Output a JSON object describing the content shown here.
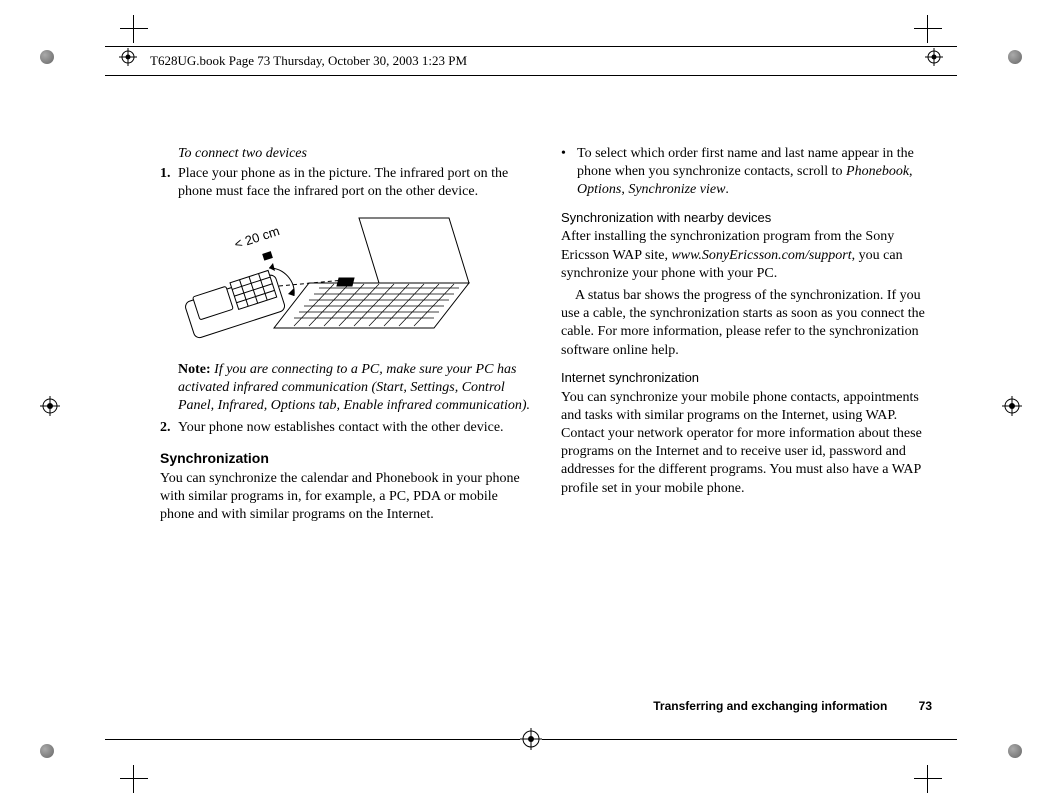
{
  "header": {
    "text": "T628UG.book  Page 73  Thursday, October 30, 2003  1:23 PM"
  },
  "left": {
    "subhead": "To connect two devices",
    "step1_num": "1.",
    "step1_body": "Place your phone as in the picture. The infrared port on the phone must face the infrared port on the other device.",
    "figure_label": "20 cm",
    "figure_lt": "<",
    "note_label": "Note:",
    "note_body": "If you are connecting to a PC, make sure your PC has activated infrared communication (Start, Settings, Control Panel, Infrared, Options tab, Enable infrared communication).",
    "step2_num": "2.",
    "step2_body": "Your phone now establishes contact with the other device.",
    "h2": "Synchronization",
    "p1": "You can synchronize the calendar and Phonebook in your phone with similar programs in, for example, a PC, PDA or mobile phone and with similar programs on the Internet."
  },
  "right": {
    "bullet_pre": "To select which order first name and last name appear in the phone when you synchronize contacts, scroll to ",
    "bullet_i1": "Phonebook",
    "bullet_sep1": ", ",
    "bullet_i2": "Options",
    "bullet_sep2": ", ",
    "bullet_i3": "Synchronize view",
    "bullet_end": ".",
    "h3a": "Synchronization with nearby devices",
    "p2a": "After installing the synchronization program from the Sony Ericsson WAP site, ",
    "p2a_site": "www.SonyEricsson.com/support",
    "p2a_end": ", you can synchronize your phone with your PC.",
    "p2b": "A status bar shows the progress of the synchronization. If you use a cable, the synchronization starts as soon as you connect the cable. For more information, please refer to the synchronization software online help.",
    "h3b": "Internet synchronization",
    "p3": "You can synchronize your mobile phone contacts, appointments and tasks with similar programs on the Internet, using WAP. Contact your network operator for more information about these programs on the Internet and to receive user id, password and addresses for the different programs. You must also have a WAP profile set in your mobile phone."
  },
  "footer": {
    "title": "Transferring and exchanging information",
    "page": "73"
  }
}
